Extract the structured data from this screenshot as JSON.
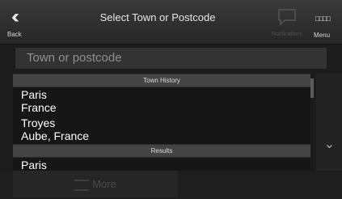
{
  "header": {
    "back_label": "Back",
    "title": "Select Town or Postcode",
    "notifications_label": "Notifications",
    "menu_label": "Menu"
  },
  "search": {
    "placeholder": "Town or postcode"
  },
  "list": {
    "history_header": "Town History",
    "history": [
      {
        "name": "Paris",
        "detail": "France"
      },
      {
        "name": "Troyes",
        "detail": "Aube, France"
      }
    ],
    "results_header": "Results",
    "results": [
      {
        "name": "Paris"
      }
    ]
  },
  "footer": {
    "more_label": "More"
  },
  "icons": {
    "back": "back-chevron-icon",
    "notifications": "speech-bubble-icon",
    "menu": "grid-menu-icon",
    "scroll_down": "chevron-down-icon",
    "more": "list-icon"
  }
}
